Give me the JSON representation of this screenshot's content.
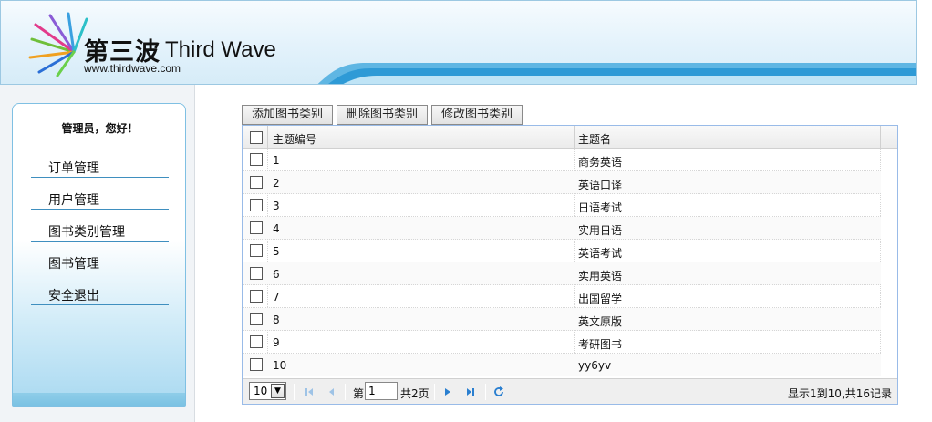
{
  "header": {
    "logo_cn": "第三波",
    "logo_en": "Third Wave",
    "logo_url": "www.thirdwave.com"
  },
  "sidebar": {
    "greeting": "管理员，您好！",
    "items": [
      {
        "label": "订单管理"
      },
      {
        "label": "用户管理"
      },
      {
        "label": "图书类别管理"
      },
      {
        "label": "图书管理"
      },
      {
        "label": "安全退出"
      }
    ]
  },
  "toolbar": {
    "add_label": "添加图书类别",
    "delete_label": "删除图书类别",
    "edit_label": "修改图书类别"
  },
  "grid": {
    "columns": [
      "主题编号",
      "主题名"
    ],
    "rows": [
      {
        "id": "1",
        "name": "商务英语"
      },
      {
        "id": "2",
        "name": "英语口译"
      },
      {
        "id": "3",
        "name": "日语考试"
      },
      {
        "id": "4",
        "name": "实用日语"
      },
      {
        "id": "5",
        "name": "英语考试"
      },
      {
        "id": "6",
        "name": "实用英语"
      },
      {
        "id": "7",
        "name": "出国留学"
      },
      {
        "id": "8",
        "name": "英文原版"
      },
      {
        "id": "9",
        "name": "考研图书"
      },
      {
        "id": "10",
        "name": "yy6yv"
      }
    ]
  },
  "pager": {
    "page_size": "10",
    "page_prefix": "第",
    "current_page": "1",
    "total_pages": "共2页",
    "summary": "显示1到10,共16记录"
  },
  "colors": {
    "accent": "#3f8fbf",
    "grid_border": "#99bbe8",
    "pager_icon": "#2a7fd0"
  },
  "icons": [
    "logo-burst-icon",
    "first-page-icon",
    "prev-page-icon",
    "next-page-icon",
    "last-page-icon",
    "refresh-icon",
    "chevron-down-icon"
  ]
}
